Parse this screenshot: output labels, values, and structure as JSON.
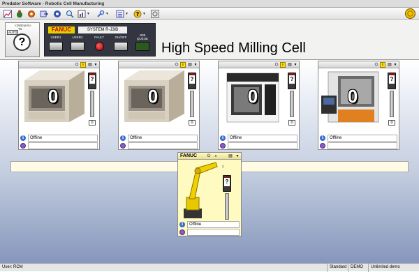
{
  "window": {
    "title": "Predator Software - Robotic Cell Manufacturing"
  },
  "toolbar": {
    "icons": [
      "chart-icon",
      "bug-icon",
      "settings-gear-icon",
      "export-icon",
      "gear-icon",
      "search-icon",
      "report-icon",
      "wrench-icon",
      "list-icon",
      "help-icon",
      "stop-icon"
    ]
  },
  "controller": {
    "speed": "<250mm/s>",
    "mode": "AUTO",
    "t1": "T1",
    "mode_indicator": "?",
    "brand": "FANUC",
    "system": "SYSTEM R-J3iB",
    "buttons": [
      "USER1",
      "USER2",
      "FAULT",
      "OH/OFF",
      "JOB QUEUE"
    ],
    "cell_title": "High Speed Milling Cell"
  },
  "machines": [
    {
      "count": "0",
      "tower": "?",
      "tower_count": "0",
      "status": "Offline",
      "field": ""
    },
    {
      "count": "0",
      "tower": "?",
      "tower_count": "0",
      "status": "Offline",
      "field": ""
    },
    {
      "count": "0",
      "tower": "?",
      "tower_count": "0",
      "status": "Offline",
      "field": ""
    },
    {
      "count": "0",
      "tower": "?",
      "tower_count": "0",
      "status": "Offline",
      "field": ""
    }
  ],
  "robot": {
    "label": "FANUC",
    "count": "0",
    "tower": "?",
    "status": "Offline",
    "field": ""
  },
  "statusbar": {
    "user": "User: RCM",
    "edition": "Standard",
    "mode": "DEMO",
    "license": "Unlimited demo"
  }
}
